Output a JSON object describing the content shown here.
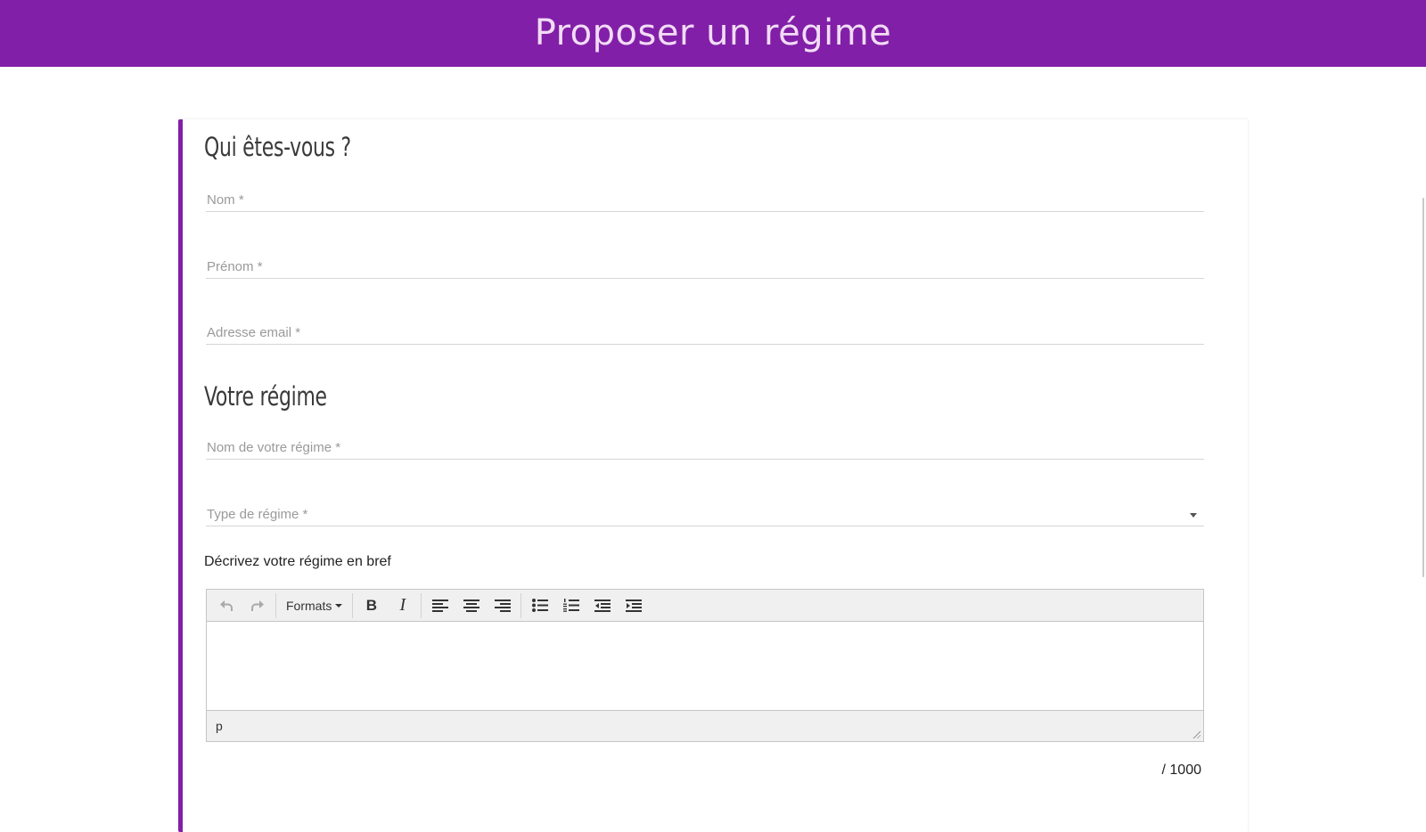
{
  "header": {
    "title": "Proposer un régime"
  },
  "sections": {
    "who": {
      "title": "Qui êtes-vous ?",
      "fields": {
        "nom": "Nom *",
        "prenom": "Prénom *",
        "email": "Adresse email *"
      }
    },
    "diet": {
      "title": "Votre régime",
      "fields": {
        "nom_regime": "Nom de votre régime *",
        "type_regime": "Type de régime *"
      },
      "description_label": "Décrivez votre régime en bref"
    }
  },
  "editor": {
    "formats_label": "Formats",
    "bold_glyph": "B",
    "italic_glyph": "I",
    "status_path": "p",
    "counter": "/ 1000",
    "icons": [
      "undo-icon",
      "redo-icon",
      "bold-icon",
      "italic-icon",
      "align-left-icon",
      "align-center-icon",
      "align-right-icon",
      "bullet-list-icon",
      "numbered-list-icon",
      "outdent-icon",
      "indent-icon",
      "resize-grip-icon"
    ]
  },
  "colors": {
    "brand": "#821fa8",
    "header_text": "#f1dcf5"
  }
}
